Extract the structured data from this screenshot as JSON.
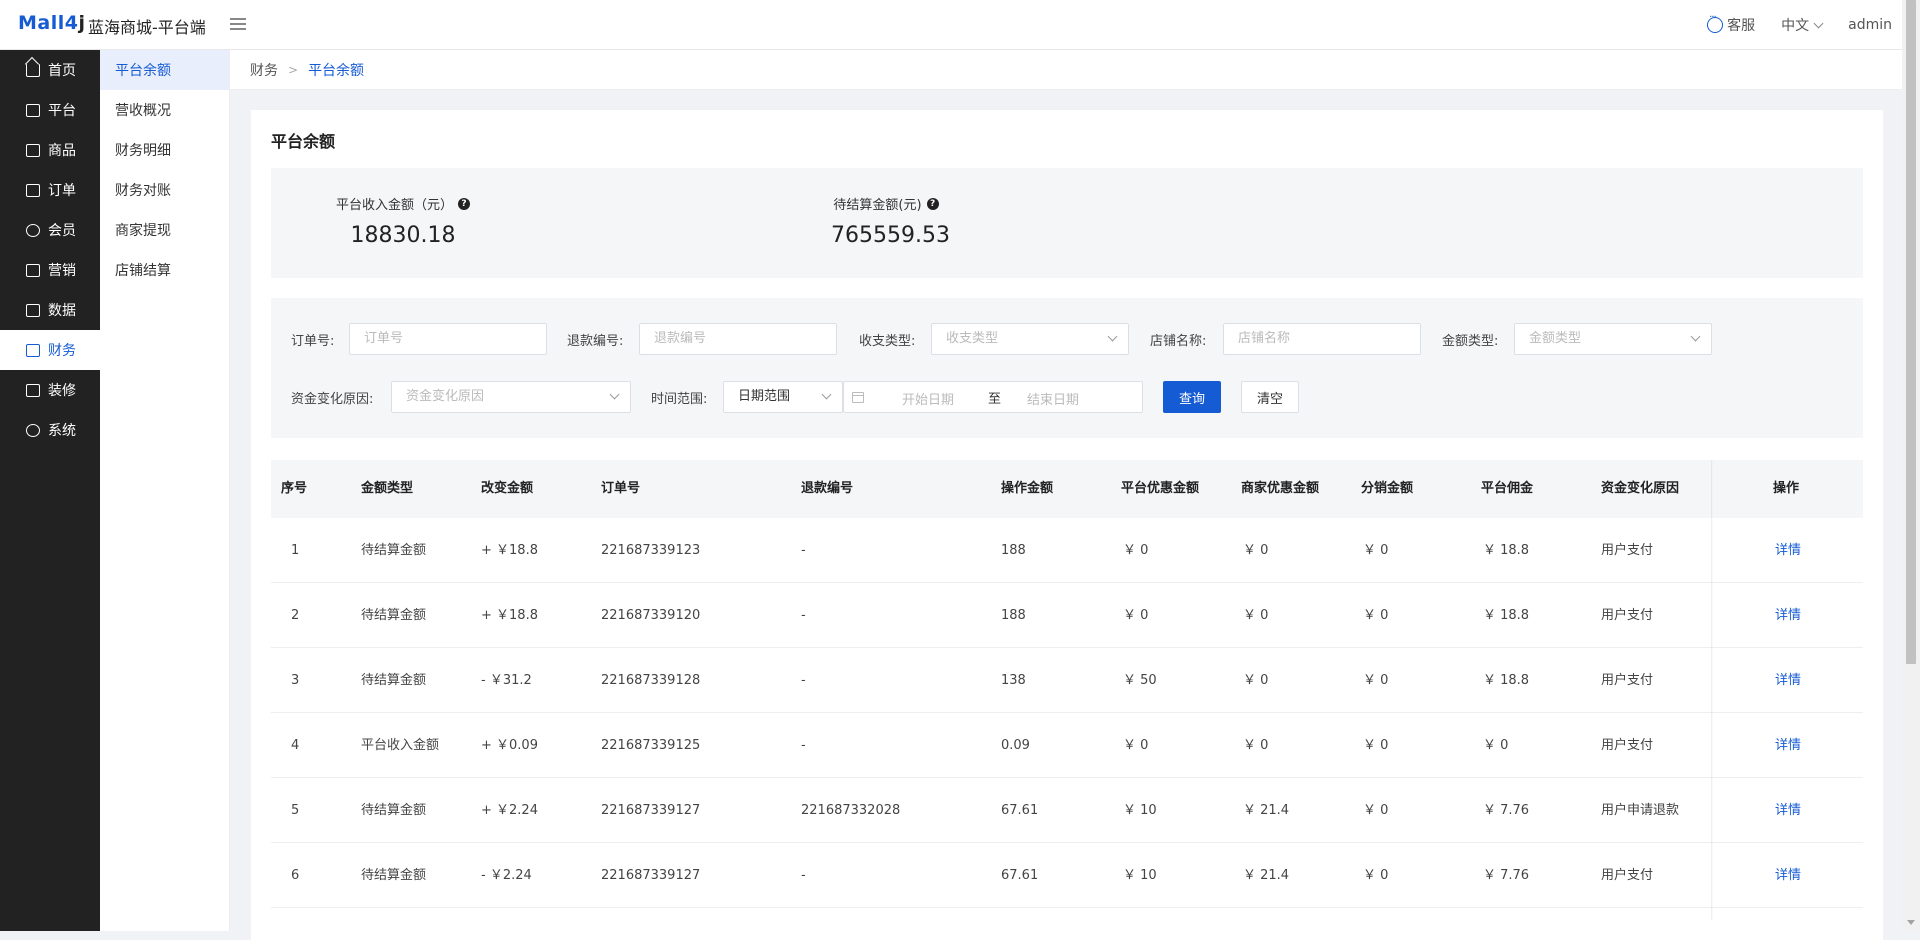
{
  "header": {
    "logo_main": "Mall4",
    "logo_j": "j",
    "title": "蓝海商城-平台端",
    "service_label": "客服",
    "language": "中文",
    "user": "admin"
  },
  "sidebar": {
    "items": [
      {
        "label": "首页",
        "icon": "home-icon"
      },
      {
        "label": "平台",
        "icon": "monitor-icon"
      },
      {
        "label": "商品",
        "icon": "bag-icon"
      },
      {
        "label": "订单",
        "icon": "document-icon"
      },
      {
        "label": "会员",
        "icon": "users-icon"
      },
      {
        "label": "营销",
        "icon": "gift-icon"
      },
      {
        "label": "数据",
        "icon": "chart-icon"
      },
      {
        "label": "财务",
        "icon": "finance-icon"
      },
      {
        "label": "装修",
        "icon": "brush-icon"
      },
      {
        "label": "系统",
        "icon": "gear-icon"
      }
    ],
    "active_index": 7
  },
  "subnav": {
    "items": [
      "平台余额",
      "营收概况",
      "财务明细",
      "财务对账",
      "商家提现",
      "店铺结算"
    ],
    "active_index": 0
  },
  "breadcrumb": [
    "财务",
    "平台余额"
  ],
  "page": {
    "title": "平台余额",
    "stats": [
      {
        "label": "平台收入金额（元）",
        "value": "18830.18"
      },
      {
        "label": "待结算金额(元)",
        "value": "765559.53"
      }
    ]
  },
  "filters": {
    "order_no": {
      "label": "订单号:",
      "placeholder": "订单号"
    },
    "refund_no": {
      "label": "退款编号:",
      "placeholder": "退款编号"
    },
    "income_type": {
      "label": "收支类型:",
      "placeholder": "收支类型"
    },
    "shop_name": {
      "label": "店铺名称:",
      "placeholder": "店铺名称"
    },
    "amount_type": {
      "label": "金额类型:",
      "placeholder": "金额类型"
    },
    "change_reason": {
      "label": "资金变化原因:",
      "placeholder": "资金变化原因"
    },
    "time_range": {
      "label": "时间范围:",
      "value": "日期范围",
      "start_placeholder": "开始日期",
      "separator": "至",
      "end_placeholder": "结束日期"
    },
    "query_button": "查询",
    "clear_button": "清空"
  },
  "table": {
    "columns": [
      "序号",
      "金额类型",
      "改变金额",
      "订单号",
      "退款编号",
      "操作金额",
      "平台优惠金额",
      "商家优惠金额",
      "分销金额",
      "平台佣金",
      "资金变化原因",
      "操作"
    ],
    "rows": [
      [
        "1",
        "待结算金额",
        "+ ￥18.8",
        "221687339123",
        "-",
        "188",
        "￥ 0",
        "￥ 0",
        "￥ 0",
        "￥ 18.8",
        "用户支付",
        "详情"
      ],
      [
        "2",
        "待结算金额",
        "+ ￥18.8",
        "221687339120",
        "-",
        "188",
        "￥ 0",
        "￥ 0",
        "￥ 0",
        "￥ 18.8",
        "用户支付",
        "详情"
      ],
      [
        "3",
        "待结算金额",
        "- ￥31.2",
        "221687339128",
        "-",
        "138",
        "￥ 50",
        "￥ 0",
        "￥ 0",
        "￥ 18.8",
        "用户支付",
        "详情"
      ],
      [
        "4",
        "平台收入金额",
        "+ ￥0.09",
        "221687339125",
        "-",
        "0.09",
        "￥ 0",
        "￥ 0",
        "￥ 0",
        "￥ 0",
        "用户支付",
        "详情"
      ],
      [
        "5",
        "待结算金额",
        "+ ￥2.24",
        "221687339127",
        "221687332028",
        "67.61",
        "￥ 10",
        "￥ 21.4",
        "￥ 0",
        "￥ 7.76",
        "用户申请退款",
        "详情"
      ],
      [
        "6",
        "待结算金额",
        "- ￥2.24",
        "221687339127",
        "-",
        "67.61",
        "￥ 10",
        "￥ 21.4",
        "￥ 0",
        "￥ 7.76",
        "用户支付",
        "详情"
      ]
    ]
  },
  "colors": {
    "accent": "#155bd4",
    "sidebar_bg": "#222222"
  }
}
